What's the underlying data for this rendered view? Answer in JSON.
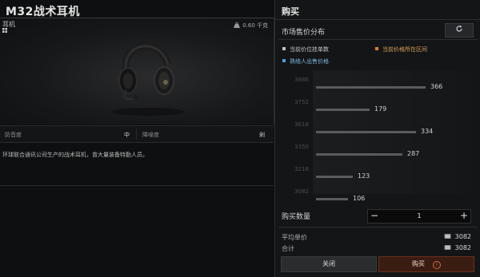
{
  "item": {
    "name": "M32战术耳机",
    "type": "耳机",
    "weight": "0.60 千克",
    "stats": [
      {
        "label": "防音度",
        "value": "中"
      },
      {
        "label": "降噪度",
        "value": "剁"
      }
    ],
    "description": "环球联合通讯公司生产的战术耳机，曾大量装备特勤人员。"
  },
  "purchase": {
    "title": "购买",
    "market_title": "市场售价分布",
    "refresh_icon": "refresh-icon",
    "legend": [
      {
        "label": "当前价位挂单数",
        "color": "#bfc1c3"
      },
      {
        "label": "当前价格所在区间",
        "color": "#d9822b"
      },
      {
        "label": "熟络人出售价格",
        "color": "#4a9fd8"
      }
    ],
    "quantity_label": "购买数量",
    "quantity_value": "1",
    "minus_label": "−",
    "plus_label": "+",
    "avg_price_label": "平均单价",
    "avg_price_value": "3082",
    "total_label": "合计",
    "total_value": "3082",
    "close_label": "关闭",
    "buy_label": "购买",
    "buy_info_icon": "i"
  },
  "chart_data": {
    "type": "bar",
    "orientation": "horizontal",
    "categories": [
      "3886",
      "3752",
      "3618",
      "3350",
      "3216",
      "3082"
    ],
    "values": [
      366,
      179,
      334,
      287,
      123,
      106
    ],
    "xlim": [
      0,
      400
    ],
    "title": "",
    "xlabel": "",
    "ylabel": ""
  }
}
